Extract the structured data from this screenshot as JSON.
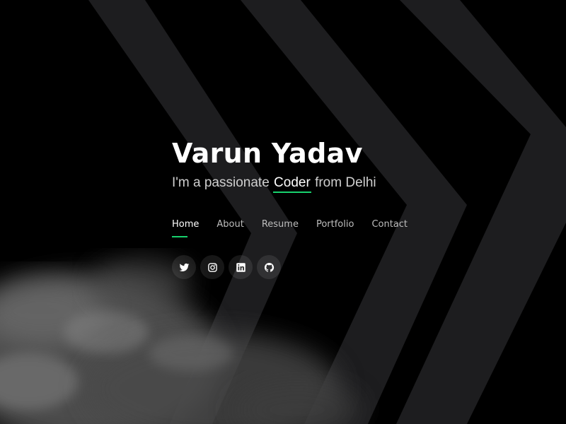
{
  "hero": {
    "name": "Varun Yadav",
    "tagline_prefix": "I'm a passionate ",
    "tagline_word": "Coder",
    "tagline_suffix": " from Delhi"
  },
  "nav": {
    "items": [
      {
        "label": "Home",
        "active": true
      },
      {
        "label": "About",
        "active": false
      },
      {
        "label": "Resume",
        "active": false
      },
      {
        "label": "Portfolio",
        "active": false
      },
      {
        "label": "Contact",
        "active": false
      }
    ]
  },
  "social": {
    "icons": [
      "twitter-icon",
      "instagram-icon",
      "linkedin-icon",
      "github-icon"
    ]
  },
  "colors": {
    "background": "#000000",
    "accent": "#18d26e",
    "chevron": "#1d1d1f",
    "text": "#ffffff"
  }
}
